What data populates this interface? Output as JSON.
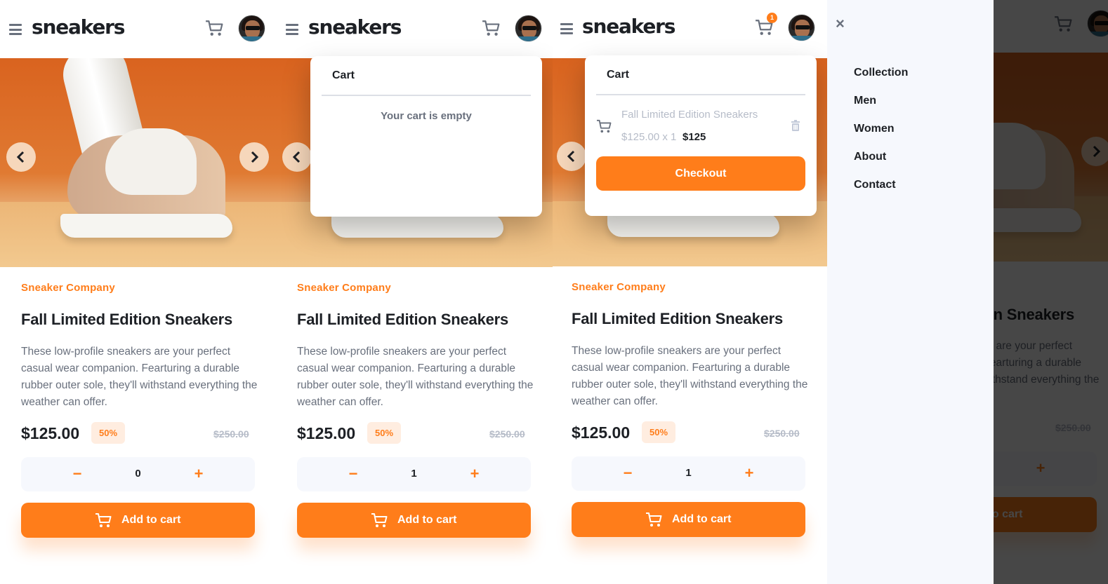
{
  "app": {
    "logo": "sneakers"
  },
  "colors": {
    "accent": "#ff7d1a",
    "accent_light": "#ffede0",
    "text_dark": "#1d2025",
    "text_grey": "#69707d",
    "text_light": "#b6bcc8",
    "surface": "#f6f8fd"
  },
  "product": {
    "company": "Sneaker Company",
    "title": "Fall Limited Edition Sneakers",
    "description": "These low-profile sneakers are your perfect casual wear companion. Fearturing a durable rubber outer sole, they'll withstand everything the weather can offer.",
    "price": "$125.00",
    "discount": "50%",
    "old_price": "$250.00",
    "add_to_cart_label": "Add to cart",
    "minus": "−",
    "plus": "+"
  },
  "panels": [
    {
      "quantity": "0",
      "cart_count": ""
    },
    {
      "quantity": "1",
      "cart_count": ""
    },
    {
      "quantity": "1",
      "cart_count": "1"
    },
    {
      "quantity": "",
      "cart_count": ""
    }
  ],
  "cart": {
    "title": "Cart",
    "empty_message": "Your cart is empty",
    "item_name": "Fall Limited Edition Sneakers",
    "item_calc": "$125.00 x 1",
    "item_total": "$125",
    "checkout_label": "Checkout"
  },
  "menu": {
    "close": "×",
    "items": [
      "Collection",
      "Men",
      "Women",
      "About",
      "Contact"
    ]
  },
  "icons": {
    "menu": "hamburger-icon",
    "cart": "cart-icon",
    "prev": "chevron-left-icon",
    "next": "chevron-right-icon",
    "delete": "trash-icon",
    "close": "close-icon"
  }
}
